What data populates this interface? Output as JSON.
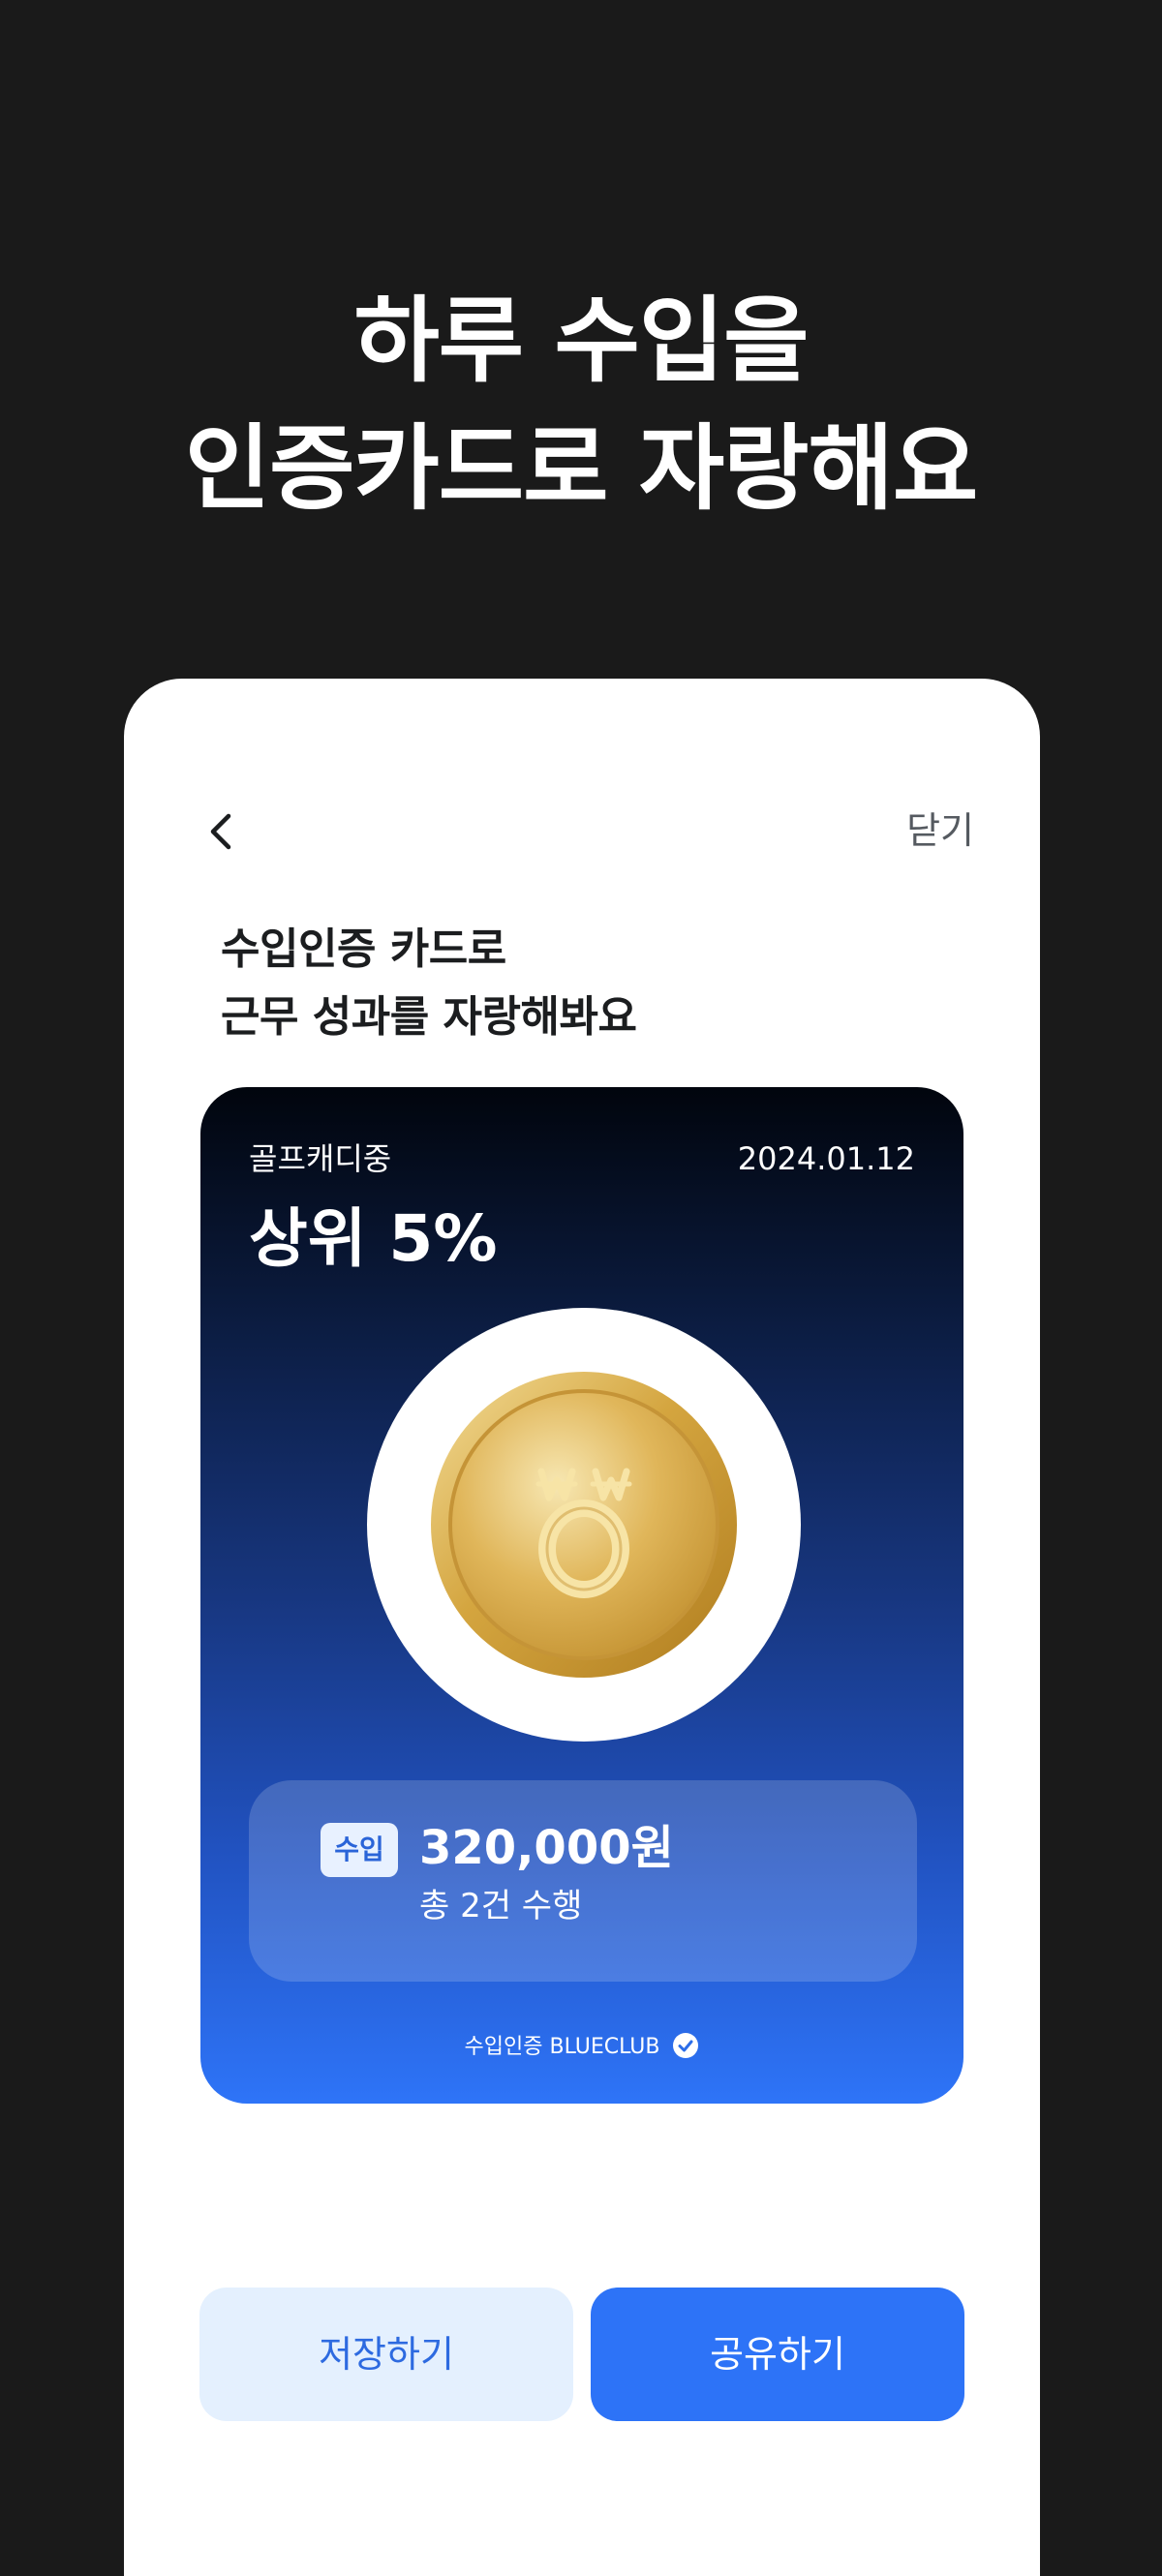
{
  "hero": {
    "line1": "하루 수입을",
    "line2": "인증카드로 자랑해요"
  },
  "nav": {
    "back_icon": "chevron-left-icon",
    "close_label": "닫기"
  },
  "heading": {
    "line1": "수입인증 카드로",
    "line2": "근무 성과를 자랑해봐요"
  },
  "card": {
    "category": "골프캐디중",
    "date": "2024.01.12",
    "rank": "상위 5%",
    "coin_icon": "gold-won-coin-icon",
    "income_badge": "수입",
    "income_amount": "320,000원",
    "task_count": "총 2건 수행",
    "footer": "수입인증 BLUECLUB",
    "verify_icon": "check-badge-icon"
  },
  "buttons": {
    "save": "저장하기",
    "share": "공유하기"
  },
  "colors": {
    "background": "#1a1a1a",
    "card_gradient_top": "#01050d",
    "card_gradient_bottom": "#2e74f8",
    "primary": "#2d73f7",
    "secondary_bg": "#e4f0fe",
    "secondary_text": "#2d6ae0"
  }
}
